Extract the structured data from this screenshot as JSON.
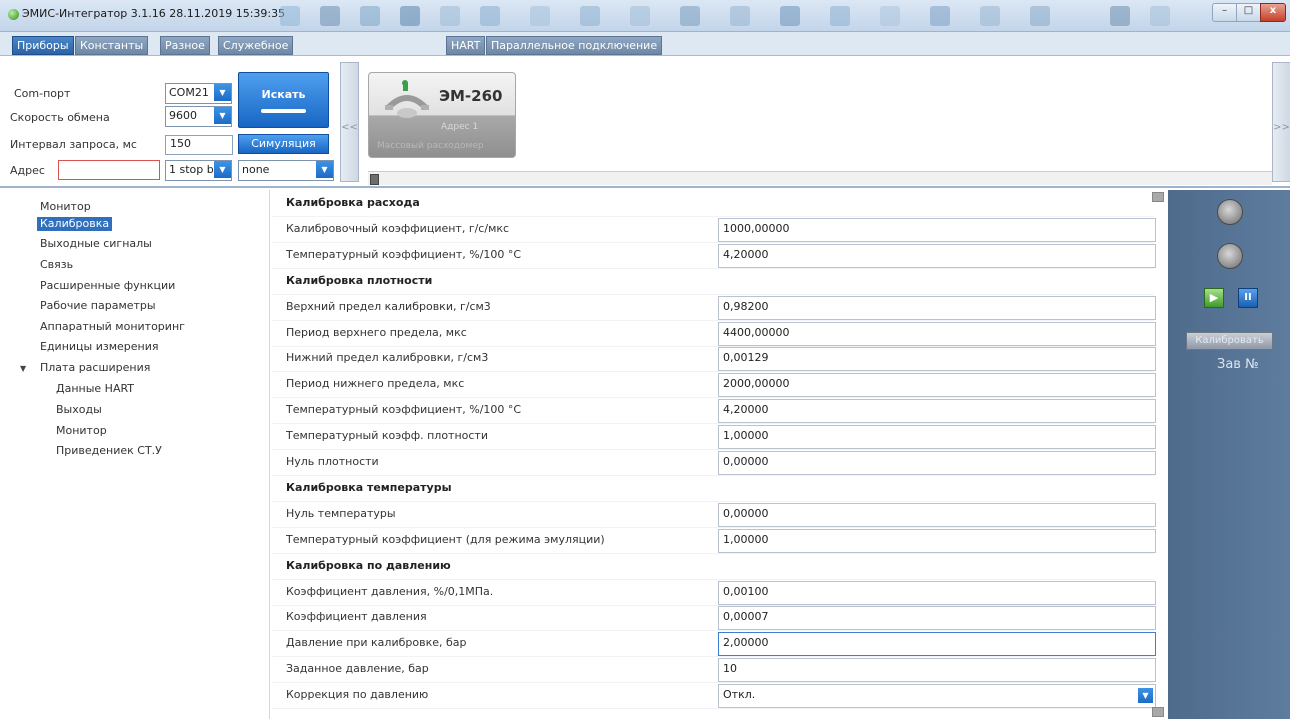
{
  "window": {
    "title": "ЭМИС-Интегратор 3.1.16 28.11.2019 15:39:35",
    "min_label": "–",
    "max_label": "□",
    "close_label": "x"
  },
  "tabs": {
    "left": [
      "Приборы",
      "Константы",
      "Разное",
      "Служебное"
    ],
    "right": [
      "HART",
      "Параллельное подключение"
    ]
  },
  "connection": {
    "com_port_label": "Com-порт",
    "com_port_value": "COM21",
    "baud_label": "Скорость обмена",
    "baud_value": "9600",
    "interval_label": "Интервал запроса, мс",
    "interval_value": "150",
    "address_label": "Адрес",
    "address_value": "",
    "stop_bits_value": "1 stop b",
    "parity_value": "none",
    "search_label": "Искать",
    "simulation_label": "Симуляция",
    "scroll_left": "<<",
    "scroll_right": ">>"
  },
  "device_card": {
    "name": "ЭМ-260",
    "address": "Адрес 1",
    "subtitle": "Массовый расходомер"
  },
  "nav": {
    "items": [
      "Монитор",
      "Калибровка",
      "Выходные сигналы",
      "Связь",
      "Расширенные функции",
      "Рабочие параметры",
      "Аппаратный мониторинг",
      "Единицы измерения",
      "Плата расширения"
    ],
    "sub_items": [
      "Данные HART",
      "Выходы",
      "Монитор",
      "Приведениек СТ.У"
    ],
    "expand_glyph": "▼"
  },
  "form": {
    "rows": [
      {
        "type": "head",
        "label": "Калибровка расхода"
      },
      {
        "type": "field",
        "label": "Калибровочный коэффициент, г/с/мкс",
        "value": "1000,00000"
      },
      {
        "type": "field",
        "label": "Температурный коэффициент, %/100 °C",
        "value": "4,20000"
      },
      {
        "type": "head",
        "label": "Калибровка плотности"
      },
      {
        "type": "field",
        "label": "Верхний предел калибровки, г/см3",
        "value": "0,98200"
      },
      {
        "type": "field",
        "label": "Период верхнего предела, мкс",
        "value": "4400,00000"
      },
      {
        "type": "field",
        "label": "Нижний предел калибровки, г/см3",
        "value": "0,00129"
      },
      {
        "type": "field",
        "label": "Период нижнего предела, мкс",
        "value": "2000,00000"
      },
      {
        "type": "field",
        "label": "Температурный коэффициент, %/100 °C",
        "value": "4,20000"
      },
      {
        "type": "field",
        "label": "Температурный коэфф. плотности",
        "value": "1,00000"
      },
      {
        "type": "field",
        "label": "Нуль плотности",
        "value": "0,00000"
      },
      {
        "type": "head",
        "label": "Калибровка температуры"
      },
      {
        "type": "field",
        "label": "Нуль температуры",
        "value": "0,00000"
      },
      {
        "type": "field",
        "label": "Температурный коэффициент (для режима эмуляции)",
        "value": "1,00000"
      },
      {
        "type": "head",
        "label": "Калибровка по давлению"
      },
      {
        "type": "field",
        "label": "Коэффициент давления, %/0,1МПа.",
        "value": "0,00100"
      },
      {
        "type": "field",
        "label": "Коэффициент давления",
        "value": "0,00007"
      },
      {
        "type": "field",
        "label": "Давление при калибровке, бар",
        "value": "2,00000",
        "focused": true
      },
      {
        "type": "field",
        "label": "Заданное давление, бар",
        "value": "10"
      },
      {
        "type": "select",
        "label": "Коррекция по давлению",
        "value": "Откл."
      }
    ]
  },
  "right_panel": {
    "play_glyph": "▶",
    "pause_glyph": "II",
    "calibrate_label": "Калибровать",
    "serial_label": "Зав №"
  },
  "colors": {
    "accent": "#1c6bc5",
    "nav_selected": "#2f6fbd",
    "right_panel": "#56738f"
  }
}
